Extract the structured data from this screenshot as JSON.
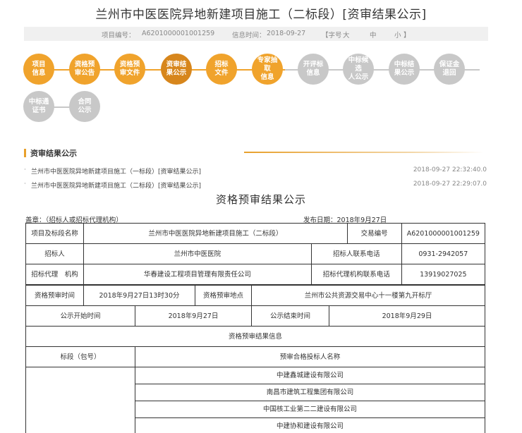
{
  "header": {
    "title": "兰州市中医医院异地新建项目施工（二标段）[资审结果公示]",
    "project_no_label": "项目编号：",
    "project_no": "A6201000001001259",
    "info_time_label": "信息时间：",
    "info_time": "2018-09-27",
    "font_size_label": "【字号",
    "size_large": "大",
    "size_medium": "中",
    "size_small": "小",
    "font_size_close": "】"
  },
  "steps": [
    {
      "l1": "项目",
      "l2": "信息",
      "state": "done"
    },
    {
      "l1": "资格预",
      "l2": "审公告",
      "state": "done"
    },
    {
      "l1": "资格预",
      "l2": "审文件",
      "state": "done"
    },
    {
      "l1": "资审结",
      "l2": "果公示",
      "state": "current"
    },
    {
      "l1": "招标",
      "l2": "文件",
      "state": "done"
    },
    {
      "l1": "专家抽取",
      "l2": "信息",
      "state": "done"
    },
    {
      "l1": "开评标",
      "l2": "信息",
      "state": "todo"
    },
    {
      "l1": "中标候选",
      "l2": "人公示",
      "state": "todo"
    },
    {
      "l1": "中标结",
      "l2": "果公示",
      "state": "todo"
    },
    {
      "l1": "保证金",
      "l2": "退回",
      "state": "todo"
    },
    {
      "l1": "中标通",
      "l2": "证书",
      "state": "todo"
    },
    {
      "l1": "合同",
      "l2": "公示",
      "state": "todo"
    }
  ],
  "section": {
    "title": "资审结果公示",
    "items": [
      {
        "text": "兰州市中医医院异地新建项目施工（一标段）[资审结果公示]",
        "date": "2018-09-27 22:32:40.0"
      },
      {
        "text": "兰州市中医医院异地新建项目施工（二标段）[资审结果公示]",
        "date": "2018-09-27 22:29:07.0"
      }
    ]
  },
  "doc": {
    "title": "资格预审结果公示",
    "seal": "盖章：（招标人或招标代理机构）",
    "publish": "发布日期：2018年9月27日"
  },
  "table": {
    "project_label": "项目及标段名称",
    "project_value": "兰州市中医医院异地新建项目施工（二标段）",
    "trade_no_label": "交易编号",
    "trade_no_value": "A6201000001001259",
    "tenderer_label": "招标人",
    "tenderer_value": "兰州市中医医院",
    "tenderer_phone_label": "招标人联系电话",
    "tenderer_phone_value": "0931-2942057",
    "agency_label": "招标代理　机构",
    "agency_value": "华春建设工程项目管理有限责任公司",
    "agency_phone_label": "招标代理机构联系电话",
    "agency_phone_value": "13919027025",
    "prequal_time_label": "资格预审时间",
    "prequal_time_value": "2018年9月27日13时30分",
    "prequal_place_label": "资格预审地点",
    "prequal_place_value": "兰州市公共资源交易中心十一楼第九开标厅",
    "pub_start_label": "公示开始时间",
    "pub_start_value": "2018年9月27日",
    "pub_end_label": "公示结束时间",
    "pub_end_value": "2018年9月29日",
    "result_header": "资格预审结果信息",
    "section_col": "标段（包号）",
    "bidders_col": "预审合格投标人名称",
    "bidders": [
      "中建鑫城建设有限公司",
      "南昌市建筑工程集团有限公司",
      "中国核工业第二二建设有限公司",
      "中建协和建设有限公司"
    ]
  }
}
